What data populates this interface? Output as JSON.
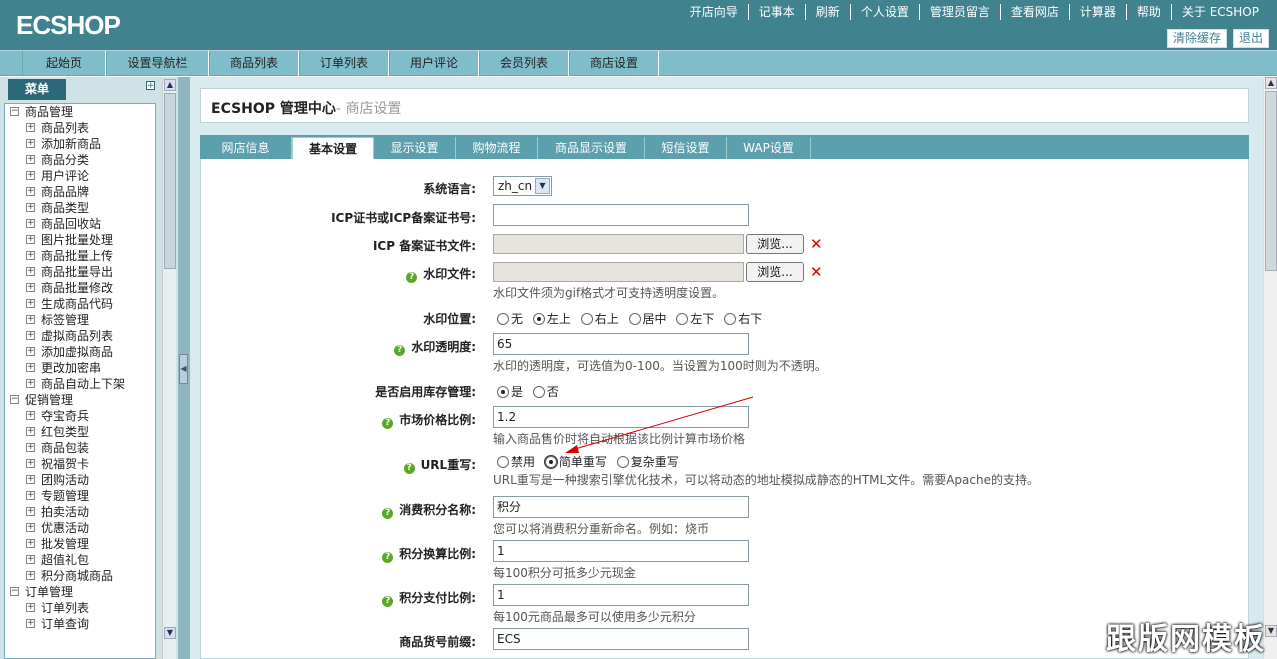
{
  "header": {
    "logo": "ECSHOP",
    "links": [
      "开店向导",
      "记事本",
      "刷新",
      "个人设置",
      "管理员留言",
      "查看网店",
      "计算器",
      "帮助",
      "关于 ECSHOP"
    ],
    "btn_clear": "清除缓存",
    "btn_logout": "退出"
  },
  "nav": [
    "起始页",
    "设置导航栏",
    "商品列表",
    "订单列表",
    "用户评论",
    "会员列表",
    "商店设置"
  ],
  "sidebar": {
    "head": "菜单",
    "groups": [
      {
        "label": "商品管理",
        "items": [
          "商品列表",
          "添加新商品",
          "商品分类",
          "用户评论",
          "商品品牌",
          "商品类型",
          "商品回收站",
          "图片批量处理",
          "商品批量上传",
          "商品批量导出",
          "商品批量修改",
          "生成商品代码",
          "标签管理",
          "虚拟商品列表",
          "添加虚拟商品",
          "更改加密串",
          "商品自动上下架"
        ]
      },
      {
        "label": "促销管理",
        "items": [
          "夺宝奇兵",
          "红包类型",
          "商品包装",
          "祝福贺卡",
          "团购活动",
          "专题管理",
          "拍卖活动",
          "优惠活动",
          "批发管理",
          "超值礼包",
          "积分商城商品"
        ]
      },
      {
        "label": "订单管理",
        "items": [
          "订单列表",
          "订单查询"
        ]
      }
    ]
  },
  "page": {
    "title": "ECSHOP 管理中心",
    "subtitle": "- 商店设置"
  },
  "tabs": [
    "网店信息",
    "基本设置",
    "显示设置",
    "购物流程",
    "商品显示设置",
    "短信设置",
    "WAP设置"
  ],
  "form": {
    "lang_label": "系统语言:",
    "lang_value": "zh_cn",
    "icp_label": "ICP证书或ICP备案证书号:",
    "icp_value": "",
    "icpfile_label": "ICP 备案证书文件:",
    "browse": "浏览...",
    "wm_label": "水印文件:",
    "wm_note": "水印文件须为gif格式才可支持透明度设置。",
    "wmpos_label": "水印位置:",
    "wmpos_opts": [
      "无",
      "左上",
      "右上",
      "居中",
      "左下",
      "右下"
    ],
    "wmalpha_label": "水印透明度:",
    "wmalpha_value": "65",
    "wmalpha_note": "水印的透明度，可选值为0-100。当设置为100时则为不透明。",
    "stock_label": "是否启用库存管理:",
    "stock_opts": [
      "是",
      "否"
    ],
    "market_label": "市场价格比例:",
    "market_value": "1.2",
    "market_note": "输入商品售价时将自动根据该比例计算市场价格",
    "url_label": "URL重写:",
    "url_opts": [
      "禁用",
      "简单重写",
      "复杂重写"
    ],
    "url_note": "URL重写是一种搜索引擎优化技术，可以将动态的地址模拟成静态的HTML文件。需要Apache的支持。",
    "point_label": "消费积分名称:",
    "point_value": "积分",
    "point_note": "您可以将消费积分重新命名。例如：烧币",
    "pointrate_label": "积分换算比例:",
    "pointrate_value": "1",
    "pointrate_note": "每100积分可抵多少元现金",
    "pointpay_label": "积分支付比例:",
    "pointpay_value": "1",
    "pointpay_note": "每100元商品最多可以使用多少元积分",
    "sn_label": "商品货号前缀:",
    "sn_value": "ECS"
  },
  "watermark": "跟版网模板"
}
